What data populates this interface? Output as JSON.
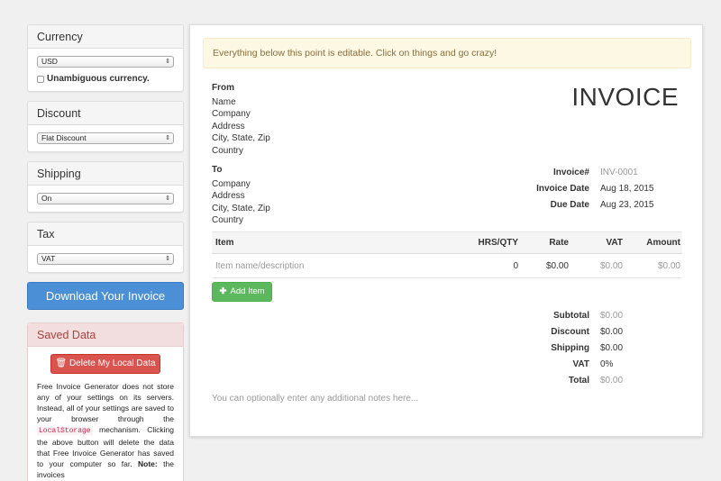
{
  "sidebar": {
    "currency": {
      "title": "Currency",
      "selected": "USD",
      "checkbox_label": "Unambiguous currency."
    },
    "discount": {
      "title": "Discount",
      "selected": "Flat Discount"
    },
    "shipping": {
      "title": "Shipping",
      "selected": "On"
    },
    "tax": {
      "title": "Tax",
      "selected": "VAT"
    },
    "download_label": "Download Your Invoice",
    "saved": {
      "title": "Saved Data",
      "delete_label": "Delete My Local Data",
      "text_1": "Free Invoice Generator does not store any of your settings on its servers. Instead, all of your settings are saved to your browser through the",
      "code": "LocalStorage",
      "text_2": "mechanism. Clicking the above button will delete the data that Free Invoice Generator has saved to your computer so far.",
      "note_label": "Note:",
      "text_3": "the invoices"
    }
  },
  "invoice": {
    "alert": "Everything below this point is editable. Click on things and go crazy!",
    "title": "INVOICE",
    "from": {
      "label": "From",
      "lines": [
        "Name",
        "Company",
        "Address",
        "City, State, Zip",
        "Country"
      ]
    },
    "to": {
      "label": "To",
      "lines": [
        "Company",
        "Address",
        "City, State, Zip",
        "Country"
      ]
    },
    "meta": [
      {
        "label": "Invoice#",
        "value": "INV-0001"
      },
      {
        "label": "Invoice Date",
        "value": "Aug 18, 2015"
      },
      {
        "label": "Due Date",
        "value": "Aug 23, 2015"
      }
    ],
    "table": {
      "headers": {
        "item": "Item",
        "qty": "HRS/QTY",
        "rate": "Rate",
        "vat": "VAT",
        "amount": "Amount"
      },
      "row": {
        "item": "Item name/description",
        "qty": "0",
        "rate": "$0.00",
        "vat": "$0.00",
        "amount": "$0.00"
      }
    },
    "add_item_label": "Add Item",
    "totals": [
      {
        "label": "Subtotal",
        "value": "$0.00"
      },
      {
        "label": "Discount",
        "value": "$0.00"
      },
      {
        "label": "Shipping",
        "value": "$0.00"
      },
      {
        "label": "VAT",
        "value": "0%"
      },
      {
        "label": "Total",
        "value": "$0.00"
      }
    ],
    "notes_placeholder": "You can optionally enter any additional notes here..."
  },
  "icons": {
    "trash": "trash-icon",
    "plus": "plus-icon",
    "dropdown": "chevron-updown-icon"
  }
}
